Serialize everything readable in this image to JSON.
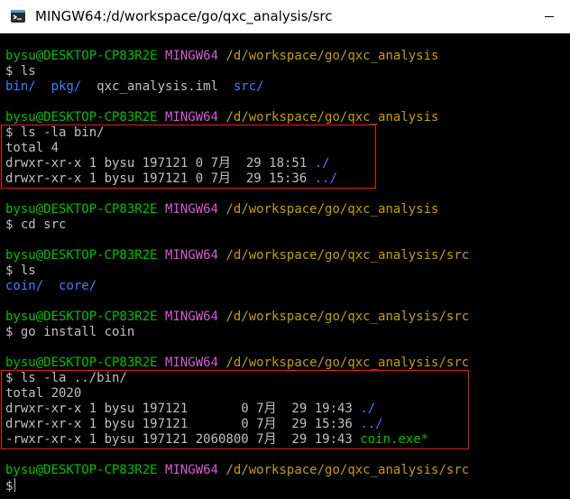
{
  "window": {
    "title": "MINGW64:/d/workspace/go/qxc_analysis/src"
  },
  "prompt": {
    "user": "bysu@DESKTOP-CP83R2E",
    "host": "MINGW64",
    "path_root": "/d/workspace/go/qxc_analysis",
    "path_src": "/d/workspace/go/qxc_analysis/src"
  },
  "cmd": {
    "ls": "$ ls",
    "ls_la_bin": "$ ls -la bin/",
    "cd_src": "$ cd src",
    "go_install": "$ go install coin",
    "ls_la_upbin": "$ ls -la ../bin/",
    "final": "$"
  },
  "listing1": {
    "bin": "bin/",
    "pkg": "pkg/",
    "iml": "qxc_analysis.iml",
    "src": "src/"
  },
  "bin_listing": {
    "total": "total 4",
    "row1_meta": "drwxr-xr-x 1 bysu 197121 0 7月  29 18:51 ",
    "row1_name": "./",
    "row2_meta": "drwxr-xr-x 1 bysu 197121 0 7月  29 15:36 ",
    "row2_name": "../"
  },
  "listing2": {
    "coin": "coin/",
    "core": "core/"
  },
  "upbin_listing": {
    "total": "total 2020",
    "row1_meta": "drwxr-xr-x 1 bysu 197121       0 7月  29 19:43 ",
    "row1_name": "./",
    "row2_meta": "drwxr-xr-x 1 bysu 197121       0 7月  29 15:36 ",
    "row2_name": "../",
    "row3_meta": "-rwxr-xr-x 1 bysu 197121 2060800 7月  29 19:43 ",
    "row3_name": "coin.exe*"
  },
  "colors": {
    "user": "#00c000",
    "host": "#d35cd3",
    "path": "#c0a000",
    "dir": "#3d7fff",
    "text": "#c0c0c0",
    "highlight": "#e02020"
  },
  "icons": {
    "app": "git-bash-icon",
    "minimize": "minimize-icon"
  }
}
